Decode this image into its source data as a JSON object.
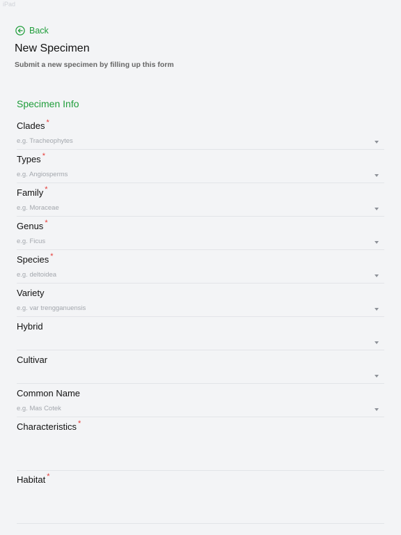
{
  "status": {
    "left": "iPad  ",
    "right": "  "
  },
  "header": {
    "back_label": "Back",
    "title": "New Specimen",
    "subtitle": "Submit a new specimen by filling up this form"
  },
  "section": {
    "title": "Specimen Info"
  },
  "fields": [
    {
      "label": "Clades",
      "required": "*",
      "placeholder": "e.g. Tracheophytes"
    },
    {
      "label": "Types",
      "required": "*",
      "placeholder": "e.g. Angiosperms"
    },
    {
      "label": "Family",
      "required": "*",
      "placeholder": "e.g. Moraceae"
    },
    {
      "label": "Genus",
      "required": "*",
      "placeholder": "e.g. Ficus"
    },
    {
      "label": "Species",
      "required": "*",
      "placeholder": "e.g. deltoidea"
    },
    {
      "label": "Variety",
      "required": "",
      "placeholder": "e.g. var trengganuensis"
    },
    {
      "label": "Hybrid",
      "required": "",
      "placeholder": ""
    },
    {
      "label": "Cultivar",
      "required": "",
      "placeholder": ""
    },
    {
      "label": "Common Name",
      "required": "",
      "placeholder": "e.g. Mas Cotek"
    }
  ],
  "textareas": [
    {
      "label": "Characteristics",
      "required": "*"
    },
    {
      "label": "Habitat",
      "required": "*"
    }
  ],
  "colors": {
    "accent": "#1f9d3a",
    "required": "#e53935",
    "background": "#f3f4f6"
  }
}
